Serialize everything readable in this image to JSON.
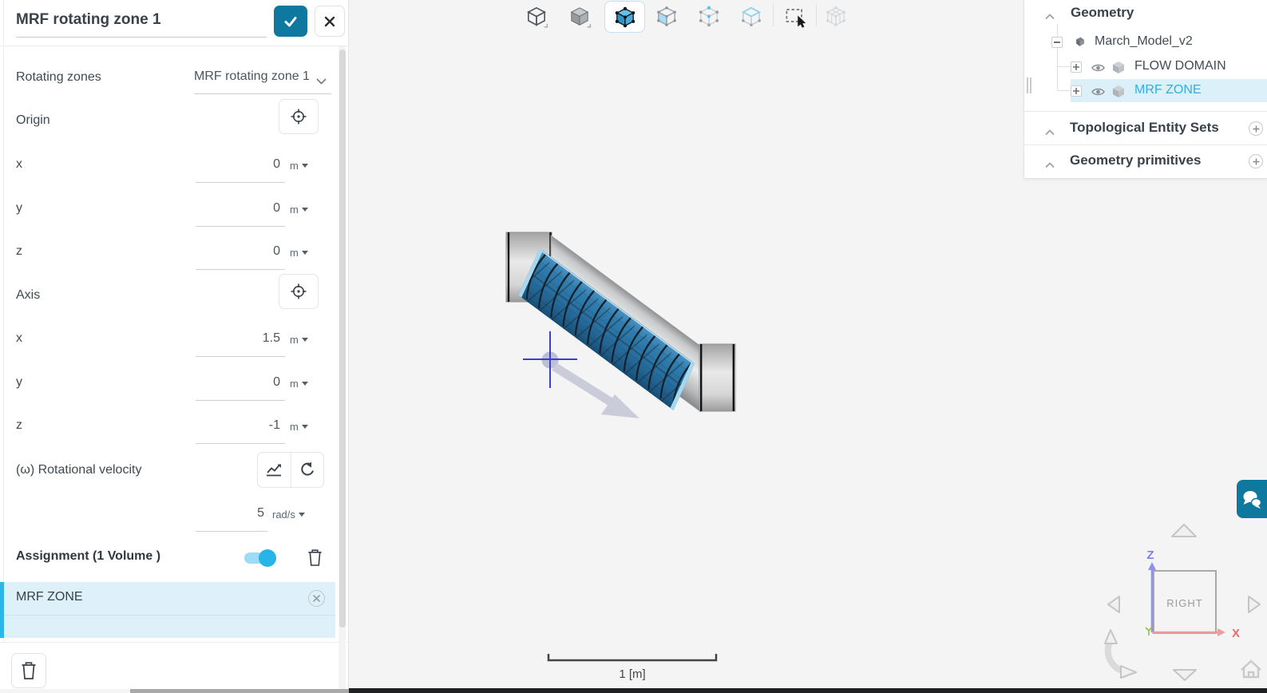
{
  "panel": {
    "title": "MRF rotating zone 1",
    "rotating_zones_label": "Rotating zones",
    "rotating_zones_value": "MRF rotating zone 1",
    "origin_label": "Origin",
    "axis_label": "Axis",
    "origin_rows": [
      {
        "label": "x",
        "value": "0",
        "unit": "m"
      },
      {
        "label": "y",
        "value": "0",
        "unit": "m"
      },
      {
        "label": "z",
        "value": "0",
        "unit": "m"
      }
    ],
    "axis_rows": [
      {
        "label": "x",
        "value": "1.5",
        "unit": "m"
      },
      {
        "label": "y",
        "value": "0",
        "unit": "m"
      },
      {
        "label": "z",
        "value": "-1",
        "unit": "m"
      }
    ],
    "velocity_label": "(ω) Rotational velocity",
    "velocity_value": "5",
    "velocity_unit": "rad/s",
    "assignment_label": "Assignment (1 Volume )",
    "assignment_items": [
      "MRF ZONE"
    ]
  },
  "tree": {
    "geometry_header": "Geometry",
    "model_name": "March_Model_v2",
    "items": [
      {
        "name": "FLOW DOMAIN",
        "selected": false
      },
      {
        "name": "MRF ZONE",
        "selected": true
      }
    ],
    "topological_header": "Topological Entity Sets",
    "primitives_header": "Geometry primitives"
  },
  "viewport": {
    "scale_label": "1 [m]",
    "toolbar": {
      "tools": [
        "view-style",
        "solid-render",
        "select-volumes",
        "select-faces",
        "select-vertices",
        "select-edges",
        "box-select",
        "select-assembly"
      ],
      "active_tool": "select-volumes"
    },
    "compass": {
      "face_label": "RIGHT",
      "x_label": "X",
      "z_label": "Z"
    }
  },
  "colors": {
    "accent_teal": "#0f789f",
    "selection_cyan": "#29b2e6",
    "selection_bg": "#def1fa",
    "mrf_blue": "#2e7aab",
    "viewport_bg": "#f4f4f5"
  }
}
